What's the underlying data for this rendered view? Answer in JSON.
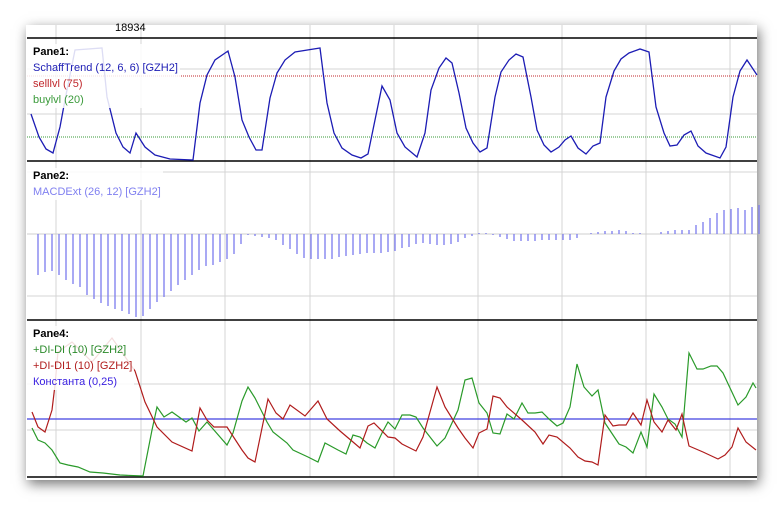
{
  "top_axis": {
    "value_label": "18934"
  },
  "panes": [
    {
      "title": "Pane1:",
      "items": [
        {
          "label": "SchaffTrend (12, 6, 6) [GZH2]",
          "color": "#1c1cb4"
        },
        {
          "label": "selllvl (75)",
          "color": "#c0282c"
        },
        {
          "label": "buylvl (20)",
          "color": "#3a9a3a"
        }
      ]
    },
    {
      "title": "Pane2:",
      "items": [
        {
          "label": "MACDExt (26, 12) [GZH2]",
          "color": "#8080f0"
        }
      ]
    },
    {
      "title": "Pane4:",
      "items": [
        {
          "label": "+DI-DI (10) [GZH2]",
          "color": "#2a8a2a"
        },
        {
          "label": "+DI-DI1 (10) [GZH2]",
          "color": "#b01c1c"
        },
        {
          "label": "Константа (0,25)",
          "color": "#3a20e0"
        }
      ]
    }
  ],
  "levels": {
    "sell": 75,
    "buy": 20,
    "constant": 0.25
  }
}
